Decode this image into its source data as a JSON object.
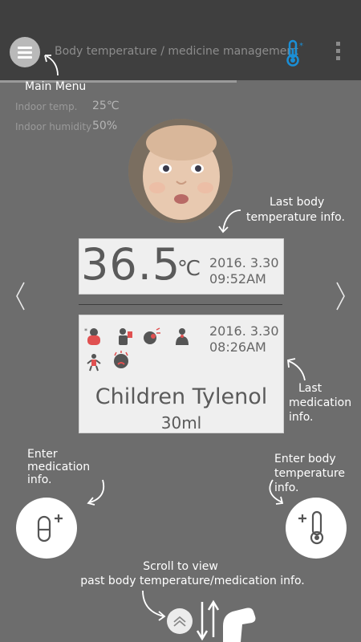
{
  "header": {
    "title": "Body temperature / medicine management",
    "menu_icon": "hamburger-icon",
    "thermometer_icon": "thermometer-icon",
    "more_icon": "more-vert-icon"
  },
  "callouts": {
    "main_menu": "Main Menu",
    "last_temp_1": "Last body",
    "last_temp_2": "temperature info.",
    "last_med_1": "Last",
    "last_med_2": "medication",
    "last_med_3": "info.",
    "enter_med_1": "Enter",
    "enter_med_2": "medication",
    "enter_med_3": "info.",
    "enter_temp_1": "Enter body",
    "enter_temp_2": "temperature",
    "enter_temp_3": "info.",
    "scroll_1": "Scroll to view",
    "scroll_2": "past body temperature/medication info."
  },
  "environment": {
    "indoor_temp_label": "Indoor temp.",
    "indoor_temp_value": "25℃",
    "indoor_humidity_label": "Indoor humidity",
    "indoor_humidity_value": "50%"
  },
  "temperature": {
    "value": "36.5",
    "unit": "℃",
    "date": "2016. 3.30",
    "time": "09:52AM"
  },
  "medication": {
    "date": "2016. 3.30",
    "time": "08:26AM",
    "name": "Children Tylenol",
    "dose": "30ml",
    "symptom_icons": [
      "chills-icon",
      "vomiting-icon",
      "cough-icon",
      "sore-throat-icon",
      "shivering-icon",
      "crying-icon"
    ]
  },
  "colors": {
    "accent_blue": "#1a8fd6",
    "accent_red": "#e05050",
    "background": "#6d6d6d",
    "topbar": "#3f3f3f"
  }
}
